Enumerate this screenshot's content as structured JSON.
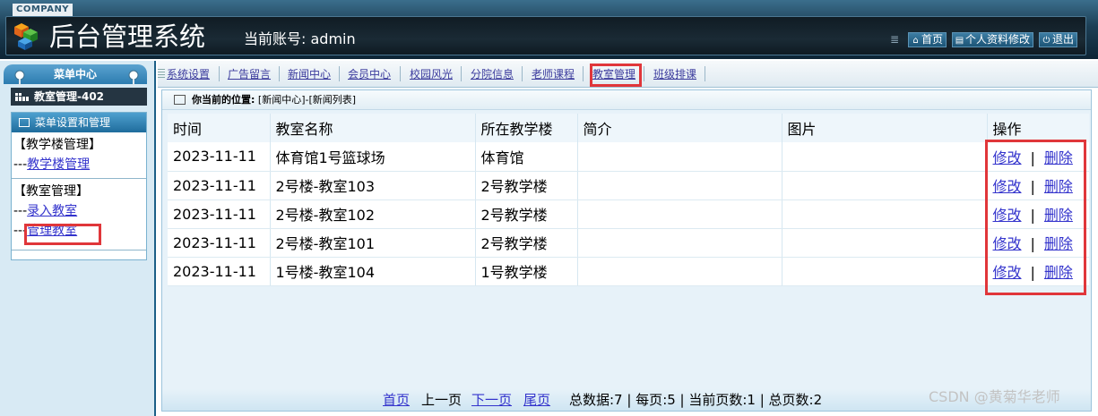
{
  "header": {
    "company": "COMPANY",
    "title": "后台管理系统",
    "account_label": "当前账号:",
    "account_name": "admin",
    "buttons": {
      "home": "首页",
      "profile": "个人资料修改",
      "logout": "退出"
    }
  },
  "sidebar": {
    "menu_center": "菜单中心",
    "current": "教室管理-402",
    "panel_title": "菜单设置和管理",
    "groups": [
      {
        "title": "【教学楼管理】",
        "items": [
          {
            "prefix": "---",
            "label": "教学楼管理"
          }
        ]
      },
      {
        "title": "【教室管理】",
        "items": [
          {
            "prefix": "---",
            "label": "录入教室"
          },
          {
            "prefix": "---",
            "label": "管理教室"
          }
        ]
      }
    ]
  },
  "topnav": {
    "items": [
      "系统设置",
      "广告留言",
      "新闻中心",
      "会员中心",
      "校园风光",
      "分院信息",
      "老师课程",
      "教室管理",
      "班级排课"
    ]
  },
  "location": {
    "label": "你当前的位置:",
    "path": "[新闻中心]-[新闻列表]"
  },
  "table": {
    "headers": [
      "时间",
      "教室名称",
      "所在教学楼",
      "简介",
      "图片",
      "操作"
    ],
    "rows": [
      {
        "time": "2023-11-11",
        "name": "体育馆1号篮球场",
        "building": "体育馆",
        "intro": "",
        "image": ""
      },
      {
        "time": "2023-11-11",
        "name": "2号楼-教室103",
        "building": "2号教学楼",
        "intro": "",
        "image": ""
      },
      {
        "time": "2023-11-11",
        "name": "2号楼-教室102",
        "building": "2号教学楼",
        "intro": "",
        "image": ""
      },
      {
        "time": "2023-11-11",
        "name": "2号楼-教室101",
        "building": "2号教学楼",
        "intro": "",
        "image": ""
      },
      {
        "time": "2023-11-11",
        "name": "1号楼-教室104",
        "building": "1号教学楼",
        "intro": "",
        "image": ""
      }
    ],
    "edit_label": "修改",
    "separator": "|",
    "delete_label": "删除"
  },
  "pager": {
    "first": "首页",
    "prev": "上一页",
    "next": "下一页",
    "last": "尾页",
    "summary": "总数据:7 | 每页:5 | 当前页数:1 | 总页数:2"
  },
  "watermark": "CSDN @黄菊华老师",
  "colors": {
    "highlight": "#e0363a",
    "link": "#3333cc",
    "header_dark": "#0d2435"
  }
}
